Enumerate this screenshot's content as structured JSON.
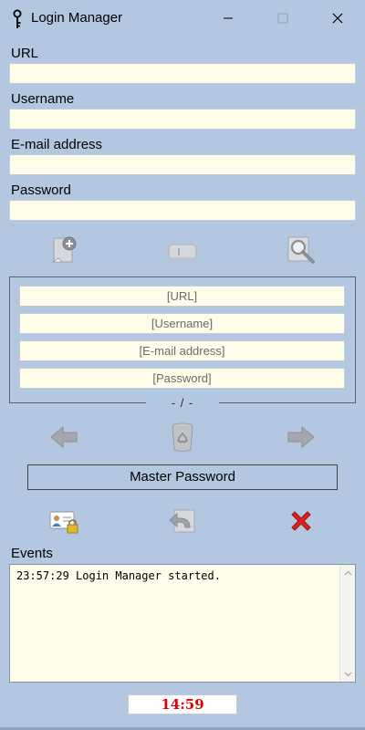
{
  "window": {
    "title": "Login Manager",
    "controls": {
      "minimize": "minimize-icon",
      "maximize": "maximize-icon",
      "close": "close-icon"
    }
  },
  "form": {
    "url_label": "URL",
    "url_value": "",
    "username_label": "Username",
    "username_value": "",
    "email_label": "E-mail address",
    "email_value": "",
    "password_label": "Password",
    "password_value": ""
  },
  "actions_top": [
    "add-entry-icon",
    "generate-icon",
    "search-icon"
  ],
  "preview": {
    "url": "[URL]",
    "username": "[Username]",
    "email": "[E-mail address]",
    "password": "[Password]",
    "counter": "- / -"
  },
  "navigation": [
    "previous-arrow-icon",
    "recycle-bin-icon",
    "next-arrow-icon"
  ],
  "master_password_label": "Master Password",
  "actions_bottom": [
    "user-card-lock-icon",
    "undo-icon",
    "delete-icon"
  ],
  "events": {
    "label": "Events",
    "log": "23:57:29 Login Manager started."
  },
  "timer": "14:59",
  "colors": {
    "background": "#b3c7e1",
    "field": "#fefde9",
    "timer_text": "#e00000",
    "delete_icon": "#e0201f"
  }
}
